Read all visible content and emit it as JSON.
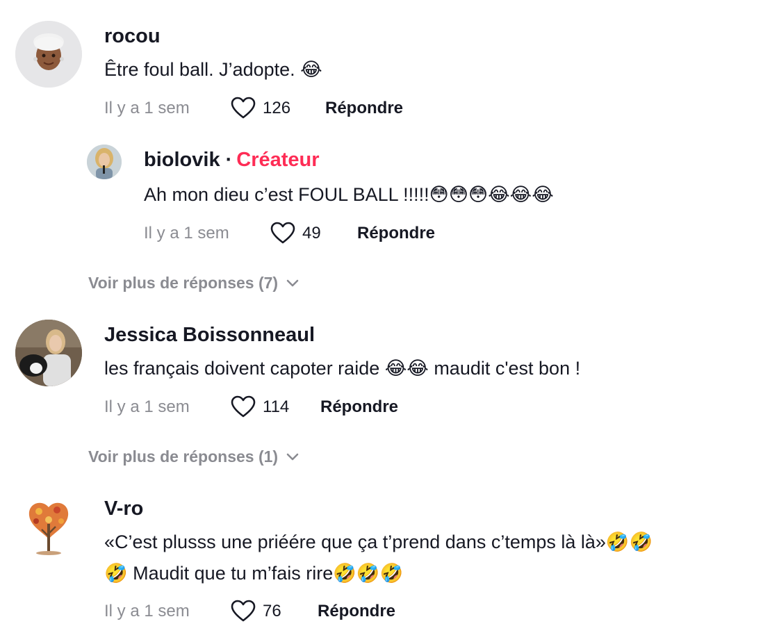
{
  "comments": [
    {
      "username": "rocou",
      "text": "Être foul ball. J’adopte. 😂",
      "time": "Il y a 1 sem",
      "likes": "126",
      "reply_label": "Répondre"
    },
    {
      "username": "biolovik",
      "separator": "·",
      "badge": "Créateur",
      "text": "Ah mon dieu c’est FOUL BALL !!!!!😳😳😳😂😂😂",
      "time": "Il y a 1 sem",
      "likes": "49",
      "reply_label": "Répondre"
    },
    {
      "username": "Jessica Boissonneaul",
      "text": "les français doivent capoter raide 😂😂 maudit c'est bon !",
      "time": "Il y a 1 sem",
      "likes": "114",
      "reply_label": "Répondre"
    },
    {
      "username": "V-ro",
      "text_line1": "«C’est plusss une priéére que ça t’prend dans c’temps là là»🤣🤣",
      "text_line2": "🤣 Maudit que tu m’fais rire🤣🤣🤣",
      "time": "Il y a 1 sem",
      "likes": "76",
      "reply_label": "Répondre"
    }
  ],
  "more_replies": [
    {
      "label": "Voir plus de réponses (7)"
    },
    {
      "label": "Voir plus de réponses (1)"
    }
  ],
  "colors": {
    "text": "#161823",
    "muted": "#8a8b91",
    "creator": "#fe2c55"
  },
  "icons": {
    "like": "heart-outline-icon",
    "expand": "chevron-down-icon"
  }
}
